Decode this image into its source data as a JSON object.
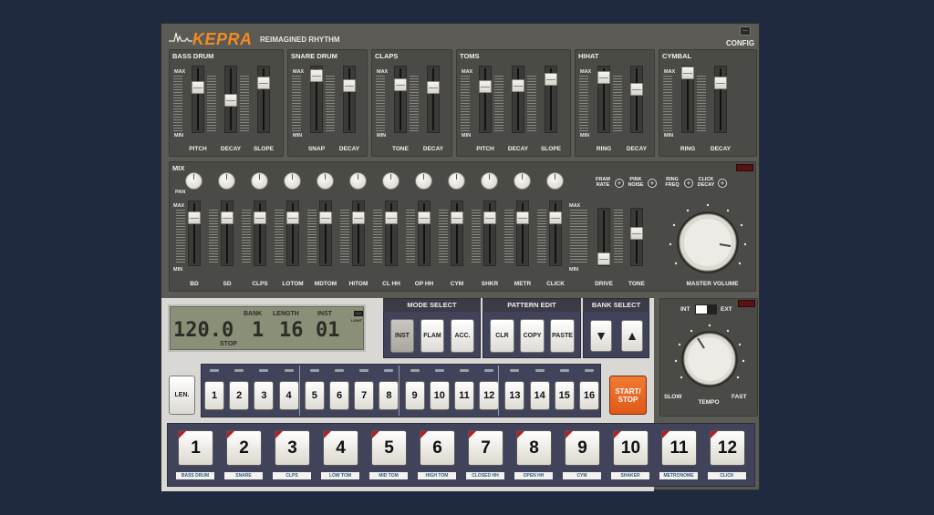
{
  "header": {
    "brand": "KEPRA",
    "tagline": "REIMAGINED RHYTHM",
    "config_label": "CONFIG",
    "config_btn": "..."
  },
  "scale_labels": {
    "max": "MAX",
    "min": "MIN"
  },
  "sound_panels": [
    {
      "title": "BASS DRUM",
      "controls": [
        "PITCH",
        "DECAY",
        "SLOPE"
      ]
    },
    {
      "title": "SNARE DRUM",
      "controls": [
        "SNAP",
        "DECAY"
      ]
    },
    {
      "title": "CLAPS",
      "controls": [
        "TONE",
        "DECAY"
      ]
    },
    {
      "title": "TOMS",
      "controls": [
        "PITCH",
        "DECAY",
        "SLOPE"
      ]
    },
    {
      "title": "HIHAT",
      "controls": [
        "RING",
        "DECAY"
      ]
    },
    {
      "title": "CYMBAL",
      "controls": [
        "RING",
        "DECAY"
      ]
    }
  ],
  "mix": {
    "title": "MIX",
    "pan_label": "PAN",
    "channels": [
      "BD",
      "SD",
      "CLPS",
      "LOTOM",
      "MDTOM",
      "HITOM",
      "CL HH",
      "OP HH",
      "CYM",
      "SHKR",
      "METR",
      "CLICK"
    ],
    "fx": [
      {
        "l1": "FRAM",
        "l2": "RATE"
      },
      {
        "l1": "PINK",
        "l2": "NOISE"
      },
      {
        "l1": "RING",
        "l2": "FREQ"
      },
      {
        "l1": "CLICK",
        "l2": "DECAY"
      }
    ],
    "drive_label": "DRIVE",
    "tone_label": "TONE",
    "master_label": "MASTER VOLUME"
  },
  "display": {
    "tempo": "120.0",
    "bank": "1",
    "length": "16",
    "inst": "01",
    "bank_label": "BANK",
    "length_label": "LENGTH",
    "inst_label": "INST",
    "status": "STOP",
    "light_label": "LIGHT"
  },
  "mode_select": {
    "title": "MODE SELECT",
    "buttons": [
      "INST",
      "FLAM",
      "ACC."
    ]
  },
  "pattern_edit": {
    "title": "PATTERN EDIT",
    "buttons": [
      "CLR",
      "COPY",
      "PASTE"
    ]
  },
  "bank_select": {
    "title": "BANK SELECT",
    "down": "▼",
    "up": "▲"
  },
  "clock": {
    "int": "INT",
    "ext": "EXT"
  },
  "tempo": {
    "label": "TEMPO",
    "slow": "SLOW",
    "fast": "FAST"
  },
  "len_label": "LEN.",
  "start_stop": {
    "l1": "START/",
    "l2": "STOP"
  },
  "steps": [
    "1",
    "2",
    "3",
    "4",
    "5",
    "6",
    "7",
    "8",
    "9",
    "10",
    "11",
    "12",
    "13",
    "14",
    "15",
    "16"
  ],
  "instruments": [
    {
      "num": "1",
      "name": "BASS DRUM"
    },
    {
      "num": "2",
      "name": "SNARE"
    },
    {
      "num": "3",
      "name": "CLPS"
    },
    {
      "num": "4",
      "name": "LOW TOM"
    },
    {
      "num": "5",
      "name": "MID TOM"
    },
    {
      "num": "6",
      "name": "HIGH TOM"
    },
    {
      "num": "7",
      "name": "CLOSED HH"
    },
    {
      "num": "8",
      "name": "OPEN HH"
    },
    {
      "num": "9",
      "name": "CYM"
    },
    {
      "num": "10",
      "name": "SHAKER"
    },
    {
      "num": "11",
      "name": "METRONOME"
    },
    {
      "num": "12",
      "name": "CLICK"
    }
  ],
  "colors": {
    "accent": "#f28a22",
    "start": "#e9621e",
    "led_red": "#b51e1e",
    "label_blue": "#2a5a86"
  }
}
